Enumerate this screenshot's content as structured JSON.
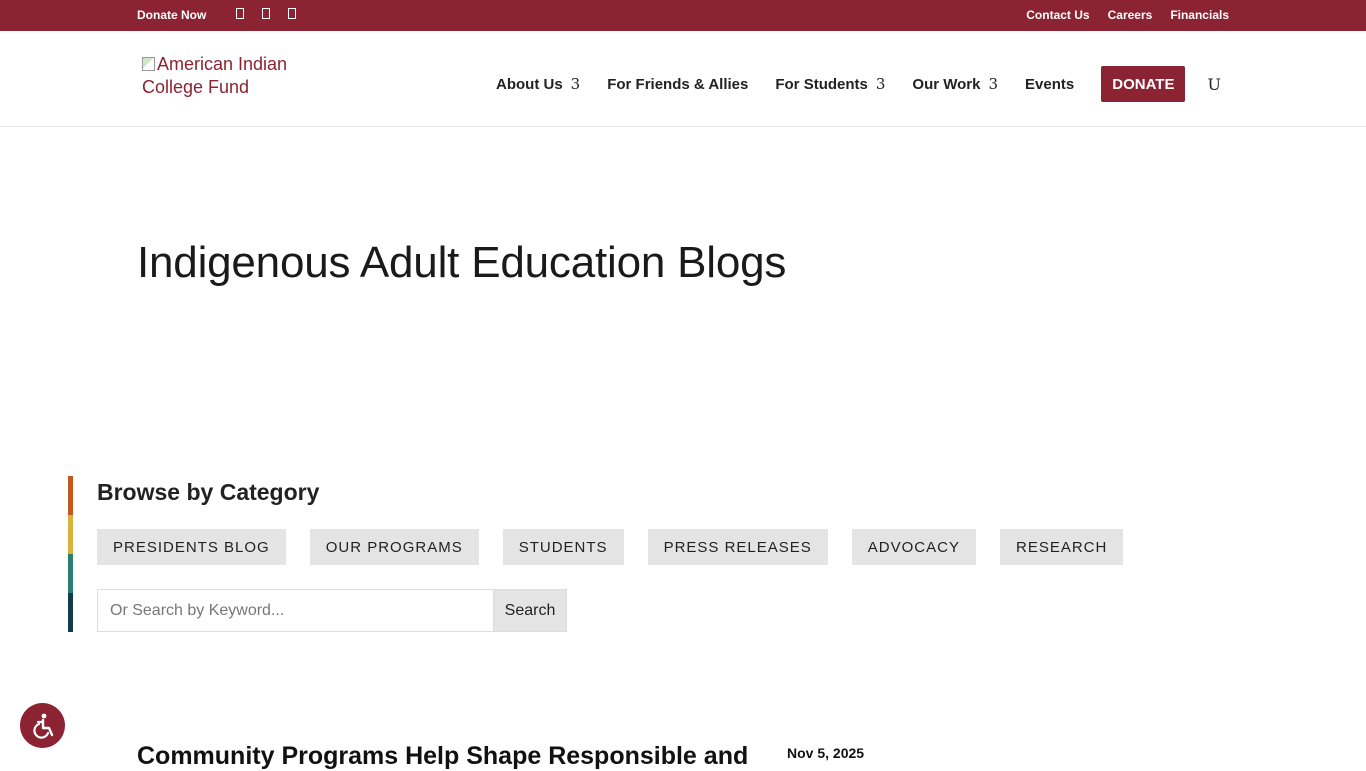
{
  "topbar": {
    "donate_now": "Donate Now",
    "links": [
      "Contact Us",
      "Careers",
      "Financials"
    ]
  },
  "logo": {
    "alt_text": "American Indian College Fund"
  },
  "nav": {
    "items": [
      "About Us",
      "For Friends & Allies",
      "For Students",
      "Our Work",
      "Events"
    ],
    "donate_label": "DONATE",
    "search_glyph": "U",
    "arrow_glyph": "3"
  },
  "page": {
    "title": "Indigenous Adult Education Blogs"
  },
  "browse": {
    "title": "Browse by Category",
    "categories": [
      "PRESIDENTS BLOG",
      "OUR PROGRAMS",
      "STUDENTS",
      "PRESS RELEASES",
      "ADVOCACY",
      "RESEARCH"
    ],
    "search_placeholder": "Or Search by Keyword...",
    "search_button": "Search"
  },
  "post": {
    "title": "Community Programs Help Shape Responsible and",
    "date": "Nov 5, 2025"
  },
  "colors": {
    "brand": "#8b2332",
    "bar": [
      "#c4591e",
      "#d8b23a",
      "#2a7f74",
      "#0f3d4e"
    ]
  },
  "icons": [
    "facebook-icon",
    "twitter-icon",
    "instagram-icon",
    "accessibility-icon"
  ]
}
